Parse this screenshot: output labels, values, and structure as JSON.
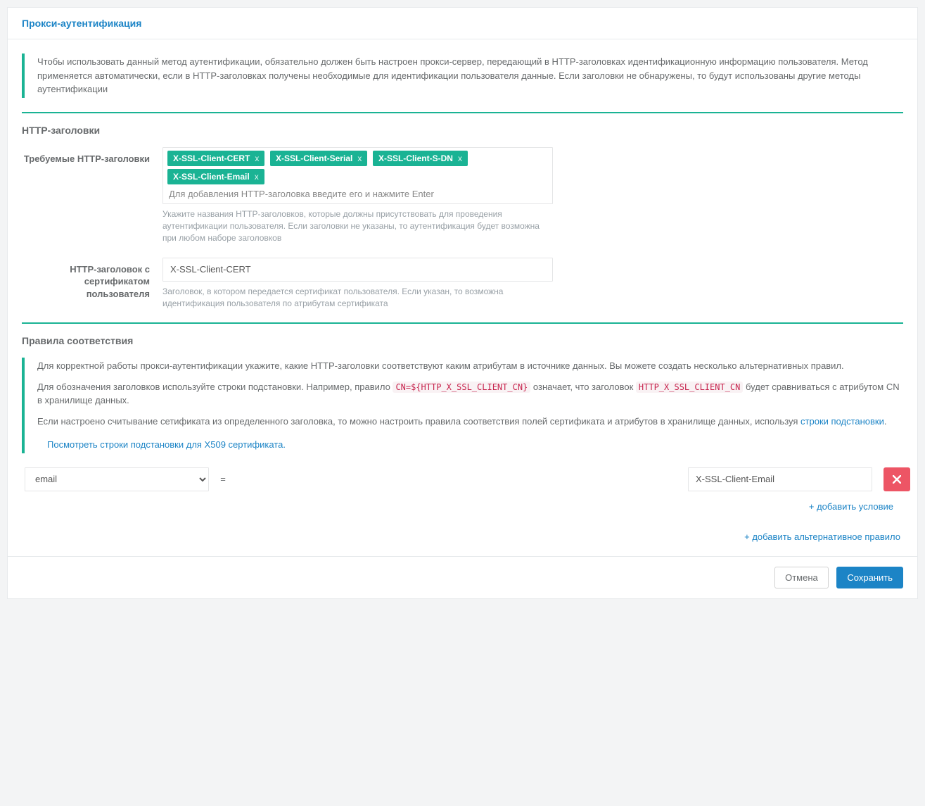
{
  "header": {
    "title": "Прокси-аутентификация"
  },
  "intro": {
    "text": "Чтобы использовать данный метод аутентификации, обязательно должен быть настроен прокси-сервер, передающий в HTTP-заголовках идентификационную информацию пользователя. Метод применяется автоматически, если в HTTP-заголовках получены необходимые для идентификации пользователя данные. Если заголовки не обнаружены, то будут использованы другие методы аутентификации"
  },
  "http_headers": {
    "section_title": "HTTP-заголовки",
    "required": {
      "label": "Требуемые HTTP-заголовки",
      "tags": [
        "X-SSL-Client-CERT",
        "X-SSL-Client-Serial",
        "X-SSL-Client-S-DN",
        "X-SSL-Client-Email"
      ],
      "placeholder": "Для добавления HTTP-заголовка введите его и нажмите Enter",
      "help": "Укажите названия HTTP-заголовков, которые должны присутствовать для проведения аутентификации пользователя. Если заголовки не указаны, то аутентификация будет возможна при любом наборе заголовков"
    },
    "cert": {
      "label": "HTTP-заголовок с сертификатом пользователя",
      "value": "X-SSL-Client-CERT",
      "help": "Заголовок, в котором передается сертификат пользователя. Если указан, то возможна идентификация пользователя по атрибутам сертификата"
    }
  },
  "rules": {
    "section_title": "Правила соответствия",
    "p1": "Для корректной работы прокси-аутентификации укажите, какие HTTP-заголовки соответствуют каким атрибутам в источнике данных. Вы можете создать несколько альтернативных правил.",
    "p2_a": "Для обозначения заголовков используйте строки подстановки. Например, правило ",
    "p2_code1": "CN=${HTTP_X_SSL_CLIENT_CN}",
    "p2_b": " означает, что заголовок ",
    "p2_code2": "HTTP_X_SSL_CLIENT_CN",
    "p2_c": " будет сравниваться с атрибутом CN в хранилище данных.",
    "p3_a": "Если настроено считывание сетификата из определенного заголовка, то можно настроить правила соответствия полей сертификата и атрибутов в хранилище данных, используя ",
    "p3_link": "строки подстановки",
    "p3_b": ".",
    "x509_link": "Посмотреть строки подстановки для X509 сертификата.",
    "rule": {
      "attr_value": "email",
      "attr_options": [
        "email"
      ],
      "eq": "=",
      "header_value": "X-SSL-Client-Email"
    },
    "add_condition": "+ добавить условие",
    "add_alt_rule": "+ добавить альтернативное правило"
  },
  "footer": {
    "cancel": "Отмена",
    "save": "Сохранить"
  }
}
